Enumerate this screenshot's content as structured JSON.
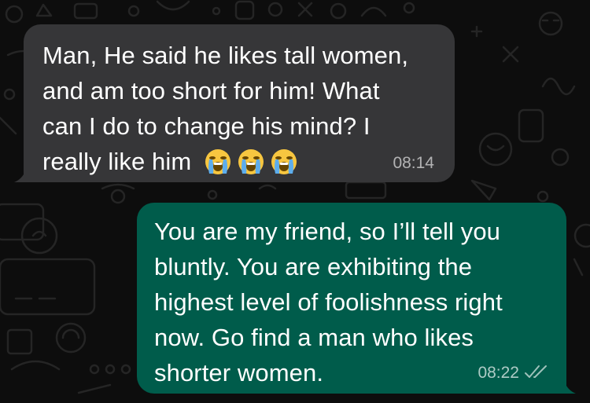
{
  "conversation": {
    "incoming": {
      "text_lines": [
        "Man, He said he likes tall women,",
        "and am too short for him! What",
        "can I do to change his mind? I",
        "really like him"
      ],
      "emojis": [
        "loudly-crying-face",
        "loudly-crying-face",
        "loudly-crying-face"
      ],
      "time": "08:14"
    },
    "outgoing": {
      "text_lines": [
        "You are my friend, so I’ll tell you",
        "bluntly. You are exhibiting the",
        "highest level of foolishness right",
        "now. Go find a man who likes",
        "shorter women."
      ],
      "time": "08:22",
      "status_icon": "double-check-icon"
    }
  },
  "colors": {
    "background": "#0d0d0d",
    "incoming_bubble": "#363638",
    "outgoing_bubble": "#005c4b",
    "text": "#ffffff"
  }
}
